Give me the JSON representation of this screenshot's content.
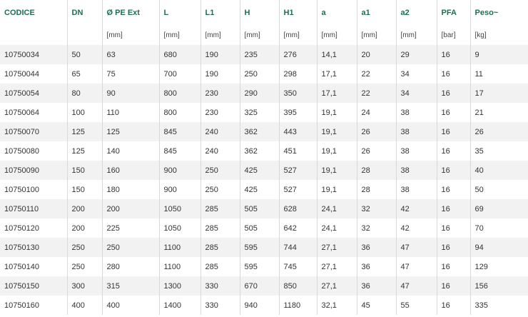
{
  "table": {
    "headers": [
      "CODICE",
      "DN",
      "Ø PE Ext",
      "L",
      "L1",
      "H",
      "H1",
      "a",
      "a1",
      "a2",
      "PFA",
      "Peso~"
    ],
    "units": [
      "",
      "",
      "[mm]",
      "[mm]",
      "[mm]",
      "[mm]",
      "[mm]",
      "[mm]",
      "[mm]",
      "[mm]",
      "[bar]",
      "[kg]"
    ],
    "rows": [
      [
        "10750034",
        "50",
        "63",
        "680",
        "190",
        "235",
        "276",
        "14,1",
        "20",
        "29",
        "16",
        "9"
      ],
      [
        "10750044",
        "65",
        "75",
        "700",
        "190",
        "250",
        "298",
        "17,1",
        "22",
        "34",
        "16",
        "11"
      ],
      [
        "10750054",
        "80",
        "90",
        "800",
        "230",
        "290",
        "350",
        "17,1",
        "22",
        "34",
        "16",
        "17"
      ],
      [
        "10750064",
        "100",
        "110",
        "800",
        "230",
        "325",
        "395",
        "19,1",
        "24",
        "38",
        "16",
        "21"
      ],
      [
        "10750070",
        "125",
        "125",
        "845",
        "240",
        "362",
        "443",
        "19,1",
        "26",
        "38",
        "16",
        "26"
      ],
      [
        "10750080",
        "125",
        "140",
        "845",
        "240",
        "362",
        "451",
        "19,1",
        "26",
        "38",
        "16",
        "35"
      ],
      [
        "10750090",
        "150",
        "160",
        "900",
        "250",
        "425",
        "527",
        "19,1",
        "28",
        "38",
        "16",
        "40"
      ],
      [
        "10750100",
        "150",
        "180",
        "900",
        "250",
        "425",
        "527",
        "19,1",
        "28",
        "38",
        "16",
        "50"
      ],
      [
        "10750110",
        "200",
        "200",
        "1050",
        "285",
        "505",
        "628",
        "24,1",
        "32",
        "42",
        "16",
        "69"
      ],
      [
        "10750120",
        "200",
        "225",
        "1050",
        "285",
        "505",
        "642",
        "24,1",
        "32",
        "42",
        "16",
        "70"
      ],
      [
        "10750130",
        "250",
        "250",
        "1100",
        "285",
        "595",
        "744",
        "27,1",
        "36",
        "47",
        "16",
        "94"
      ],
      [
        "10750140",
        "250",
        "280",
        "1100",
        "285",
        "595",
        "745",
        "27,1",
        "36",
        "47",
        "16",
        "129"
      ],
      [
        "10750150",
        "300",
        "315",
        "1300",
        "330",
        "670",
        "850",
        "27,1",
        "36",
        "47",
        "16",
        "156"
      ],
      [
        "10750160",
        "400",
        "400",
        "1400",
        "330",
        "940",
        "1180",
        "32,1",
        "45",
        "55",
        "16",
        "335"
      ]
    ],
    "colors": {
      "header_text": "#1b6e55",
      "stripe": "#f2f2f2",
      "divider": "#d8d8d8",
      "cell_text": "#333333"
    }
  }
}
